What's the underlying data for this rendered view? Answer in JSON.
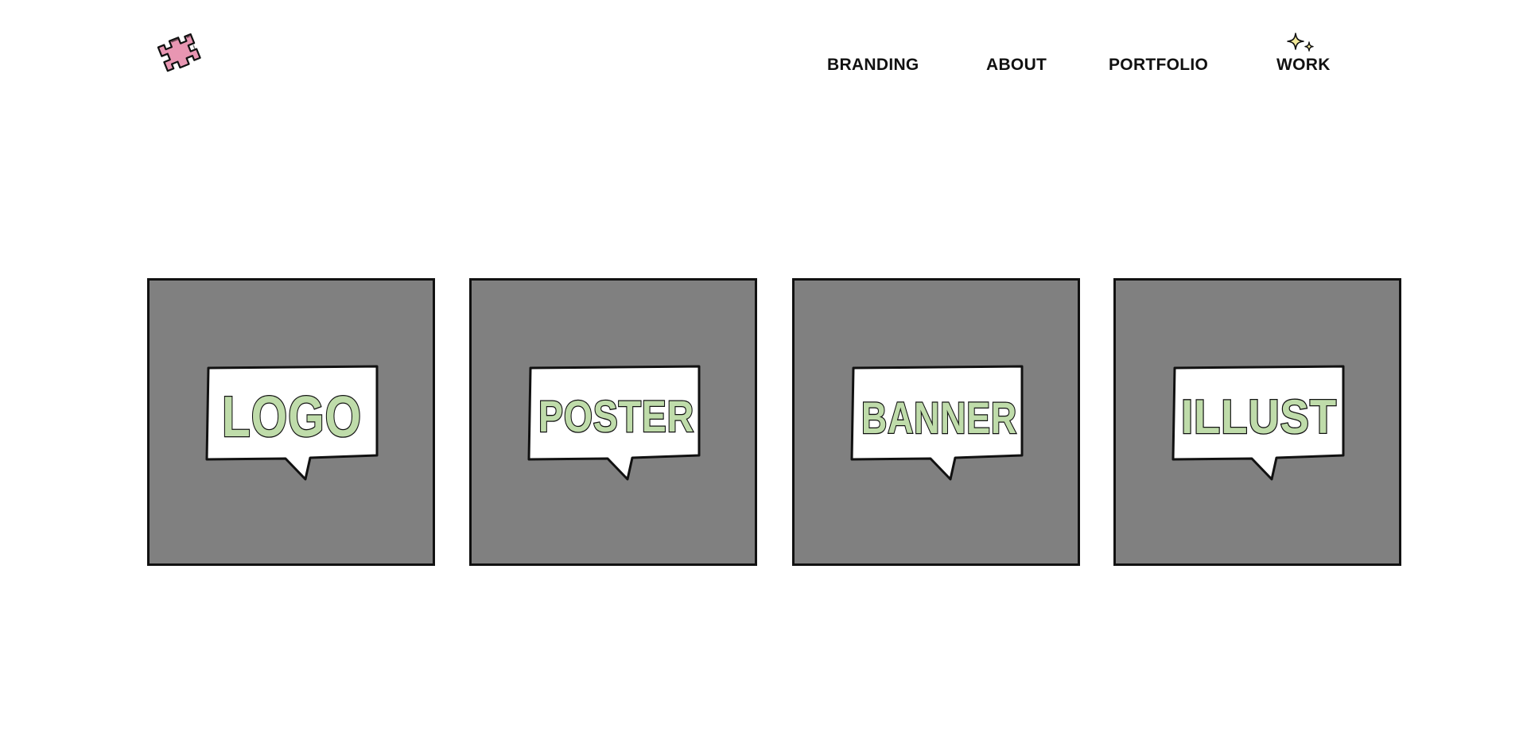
{
  "logo": {
    "icon": "puzzle-hash-icon",
    "color": "#e896b2"
  },
  "nav": {
    "items": [
      {
        "label": "BRANDING"
      },
      {
        "label": "ABOUT"
      },
      {
        "label": "PORTFOLIO"
      },
      {
        "label": "WORK"
      }
    ],
    "work_decoration": {
      "icon": "sparkle-icon",
      "color": "#f3ea9a"
    }
  },
  "cards": [
    {
      "label": "LOGO"
    },
    {
      "label": "POSTER"
    },
    {
      "label": "BANNER"
    },
    {
      "label": "ILLUST"
    }
  ],
  "colors": {
    "background": "#ffffff",
    "card": "#808080",
    "bubble": "#ffffff",
    "lettering": "#bfdcaa",
    "outline": "#111111"
  }
}
